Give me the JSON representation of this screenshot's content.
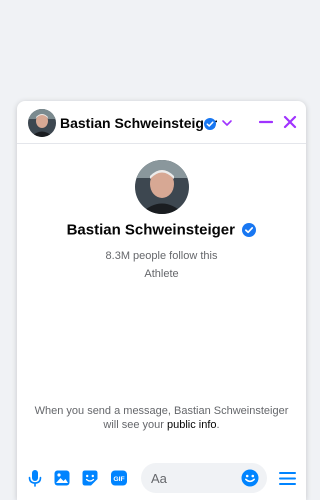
{
  "header": {
    "name": "Bastian Schweinsteiger"
  },
  "profile": {
    "name": "Bastian Schweinsteiger",
    "followers": "8.3M people follow this",
    "category": "Athlete"
  },
  "notice": {
    "text": "When you send a message, Bastian Schweinsteiger will see your ",
    "link": "public info",
    "suffix": "."
  },
  "composer": {
    "placeholder": "Aa",
    "icons": [
      "microphone-icon",
      "photo-icon",
      "sticker-icon",
      "gif-icon",
      "emoji-icon",
      "menu-icon"
    ]
  },
  "colors": {
    "accent": "#0084ff",
    "header_controls": "#a033ff",
    "verified": "#1877f2"
  }
}
